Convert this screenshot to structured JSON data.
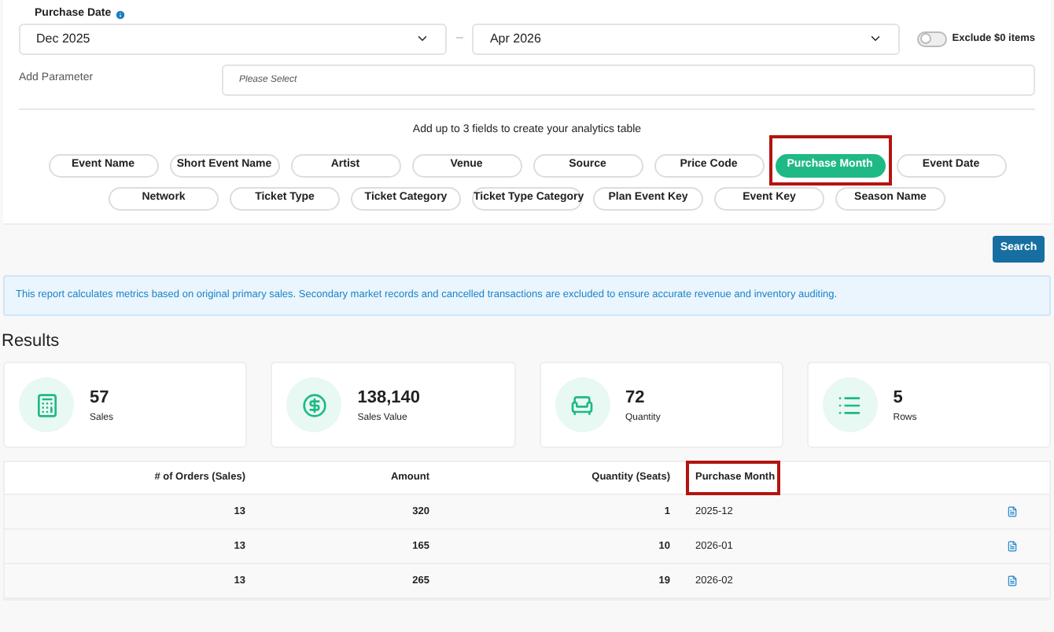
{
  "filters": {
    "purchase_date_label": "Purchase Date",
    "start": "Dec 2025",
    "separator": "–",
    "end": "Apr 2026",
    "exclude_zero": {
      "label": "Exclude $0 items",
      "on": false
    }
  },
  "add_parameter": {
    "label": "Add Parameter",
    "placeholder": "Please Select"
  },
  "fields_hint": "Add up to 3 fields to create your analytics table",
  "field_rows": [
    [
      {
        "label": "Event Name",
        "selected": false,
        "highlighted": false
      },
      {
        "label": "Short Event Name",
        "selected": false,
        "highlighted": false
      },
      {
        "label": "Artist",
        "selected": false,
        "highlighted": false
      },
      {
        "label": "Venue",
        "selected": false,
        "highlighted": false
      },
      {
        "label": "Source",
        "selected": false,
        "highlighted": false
      },
      {
        "label": "Price Code",
        "selected": false,
        "highlighted": false
      },
      {
        "label": "Purchase Month",
        "selected": true,
        "highlighted": true
      },
      {
        "label": "Event Date",
        "selected": false,
        "highlighted": false
      }
    ],
    [
      {
        "label": "Network",
        "selected": false,
        "highlighted": false
      },
      {
        "label": "Ticket Type",
        "selected": false,
        "highlighted": false
      },
      {
        "label": "Ticket Category",
        "selected": false,
        "highlighted": false
      },
      {
        "label": "Ticket Type Category",
        "selected": false,
        "highlighted": false
      },
      {
        "label": "Plan Event Key",
        "selected": false,
        "highlighted": false
      },
      {
        "label": "Event Key",
        "selected": false,
        "highlighted": false
      },
      {
        "label": "Season Name",
        "selected": false,
        "highlighted": false
      }
    ]
  ],
  "search_button": "Search",
  "info": "This report calculates metrics based on original primary sales. Secondary market records and cancelled transactions are excluded to ensure accurate revenue and inventory auditing.",
  "results_title": "Results",
  "stats": [
    {
      "kind": "sales",
      "value": "57",
      "label": "Sales"
    },
    {
      "kind": "value",
      "value": "138,140",
      "label": "Sales Value"
    },
    {
      "kind": "quantity",
      "value": "72",
      "label": "Quantity"
    },
    {
      "kind": "rows",
      "value": "5",
      "label": "Rows"
    }
  ],
  "table": {
    "columns": [
      {
        "label": "# of Orders (Sales)",
        "highlighted": false
      },
      {
        "label": "Amount",
        "highlighted": false
      },
      {
        "label": "Quantity (Seats)",
        "highlighted": false
      },
      {
        "label": "Purchase Month",
        "highlighted": true
      }
    ],
    "rows": [
      [
        "13",
        "320",
        "1",
        "2025-12"
      ],
      [
        "13",
        "165",
        "10",
        "2026-01"
      ],
      [
        "13",
        "265",
        "19",
        "2026-02"
      ]
    ]
  }
}
